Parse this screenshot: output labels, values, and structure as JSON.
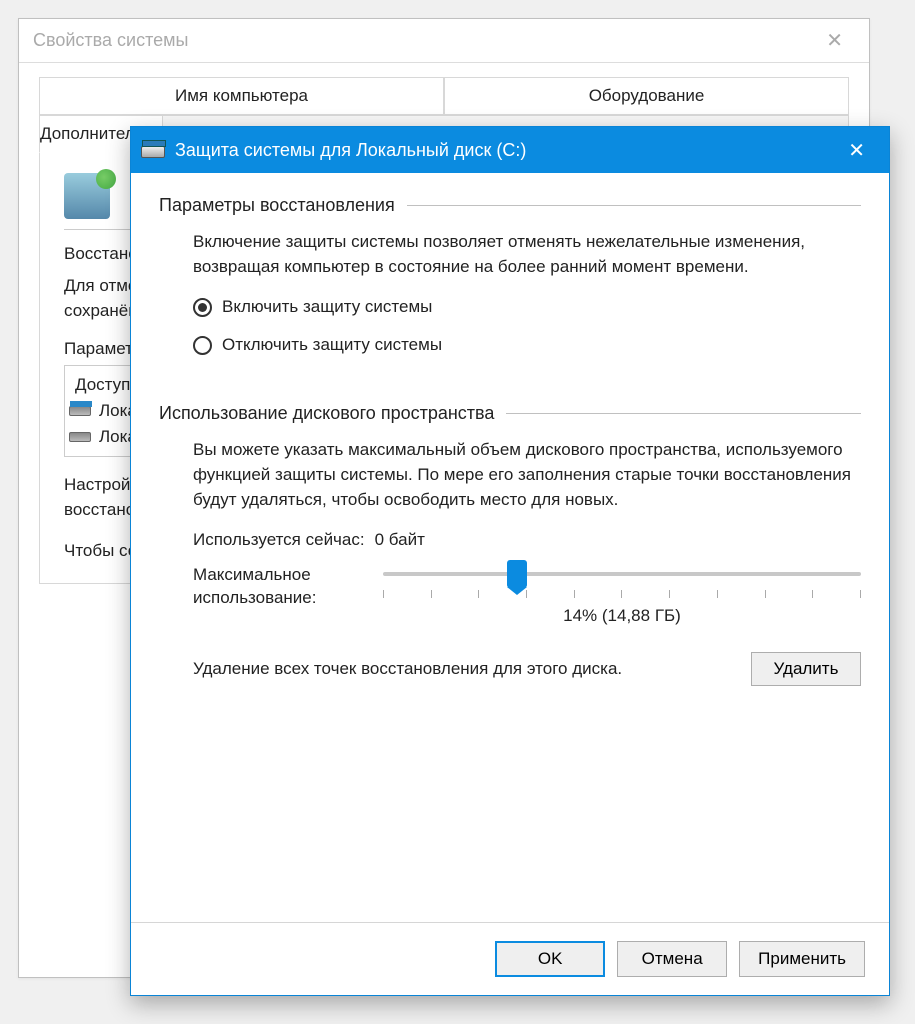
{
  "parent": {
    "title": "Свойства системы",
    "close_glyph": "✕",
    "tabs": {
      "row1": [
        "Имя компьютера",
        "Оборудование"
      ],
      "row2": [
        "Дополнительно"
      ]
    },
    "restore_label": "Восстановление системы",
    "restore_desc": "Для отмены нежелательных изменений системы вы можете восстановить её до состояния, сохранённого в точке восстановления, выбрав соответствующую точку восстановления.",
    "params_heading": "Параметры защиты",
    "list_header": "Доступные диски",
    "list_item_l": "Локальный диск",
    "configure_desc": "Настройте параметры восстановления, управляйте дисковым пространством и удаляйте точки восстановления.",
    "create_desc": "Чтобы создать точку восстановления, необходимо сначала выбрать диск и включить защиту."
  },
  "dialog": {
    "title": "Защита системы для Локальный диск (C:)",
    "close_glyph": "✕",
    "restore_section": "Параметры восстановления",
    "restore_desc": "Включение защиты системы позволяет отменять нежелательные изменения, возвращая компьютер в состояние на более ранний момент времени.",
    "radio_enable": "Включить защиту системы",
    "radio_disable": "Отключить защиту системы",
    "disk_section": "Использование дискового пространства",
    "disk_desc": "Вы можете указать максимальный объем дискового пространства, используемого функцией защиты системы. По мере его заполнения старые точки восстановления будут удаляться, чтобы освободить место для новых.",
    "current_usage_label": "Используется сейчас:",
    "current_usage_value": "0 байт",
    "max_usage_label": "Максимальное использование:",
    "slider_value": "14% (14,88 ГБ)",
    "slider_percent": 14,
    "delete_desc": "Удаление всех точек восстановления для этого диска.",
    "delete_btn": "Удалить",
    "ok_btn": "OK",
    "cancel_btn": "Отмена",
    "apply_btn": "Применить"
  }
}
